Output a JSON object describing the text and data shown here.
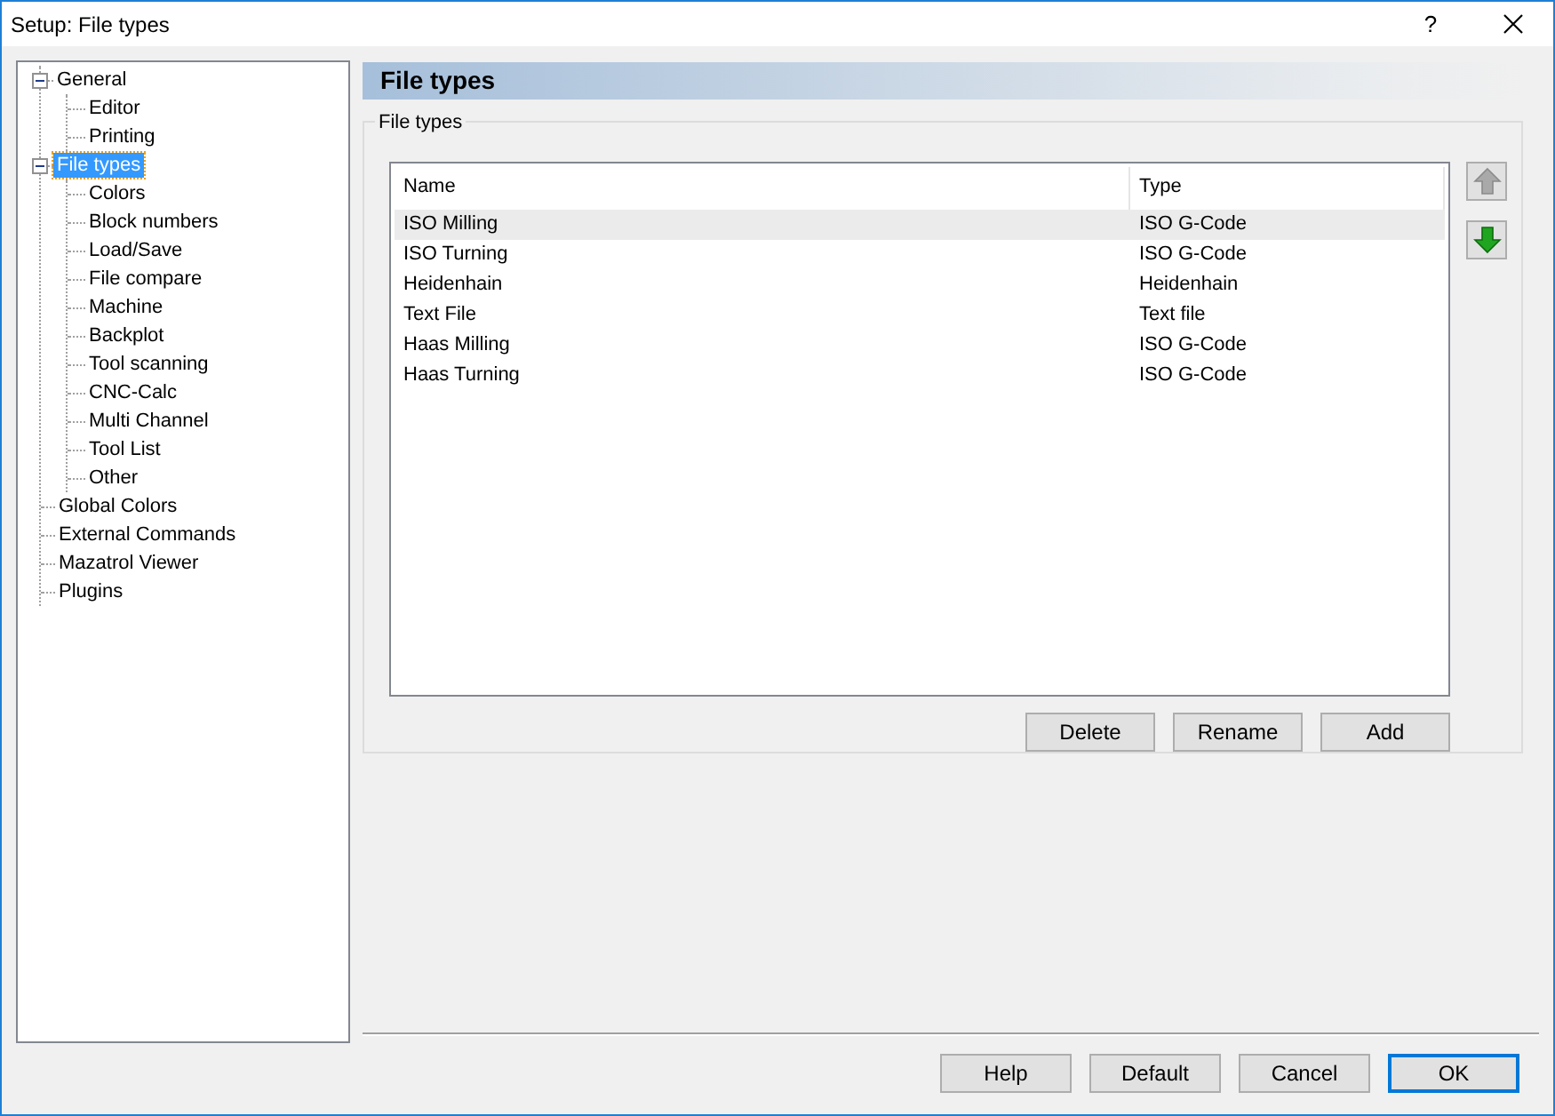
{
  "window": {
    "title": "Setup: File types",
    "help": "?"
  },
  "tree": [
    {
      "label": "General",
      "expanded": true,
      "selected": false,
      "children": [
        {
          "label": "Editor",
          "selected": false
        },
        {
          "label": "Printing",
          "selected": false
        }
      ]
    },
    {
      "label": "File types",
      "expanded": true,
      "selected": true,
      "children": [
        {
          "label": "Colors",
          "selected": false
        },
        {
          "label": "Block numbers",
          "selected": false
        },
        {
          "label": "Load/Save",
          "selected": false
        },
        {
          "label": "File compare",
          "selected": false
        },
        {
          "label": "Machine",
          "selected": false
        },
        {
          "label": "Backplot",
          "selected": false
        },
        {
          "label": "Tool scanning",
          "selected": false
        },
        {
          "label": "CNC-Calc",
          "selected": false
        },
        {
          "label": "Multi Channel",
          "selected": false
        },
        {
          "label": "Tool List",
          "selected": false
        },
        {
          "label": "Other",
          "selected": false
        }
      ]
    },
    {
      "label": "Global Colors",
      "selected": false
    },
    {
      "label": "External Commands",
      "selected": false
    },
    {
      "label": "Mazatrol Viewer",
      "selected": false
    },
    {
      "label": "Plugins",
      "selected": false
    }
  ],
  "page_title": "File types",
  "group_title": "File types",
  "table": {
    "columns": [
      "Name",
      "Type"
    ],
    "rows": [
      {
        "cells": [
          "ISO Milling",
          "ISO G-Code"
        ],
        "selected": true
      },
      {
        "cells": [
          "ISO Turning",
          "ISO G-Code"
        ],
        "selected": false
      },
      {
        "cells": [
          "Heidenhain",
          "Heidenhain"
        ],
        "selected": false
      },
      {
        "cells": [
          "Text File",
          "Text file"
        ],
        "selected": false
      },
      {
        "cells": [
          "Haas Milling",
          "ISO G-Code"
        ],
        "selected": false
      },
      {
        "cells": [
          "Haas Turning",
          "ISO G-Code"
        ],
        "selected": false
      }
    ]
  },
  "move_buttons": [
    {
      "kind": "up",
      "disabled": true
    },
    {
      "kind": "down",
      "disabled": false
    }
  ],
  "list_buttons": [
    "Delete",
    "Rename",
    "Add"
  ],
  "dialog_buttons": [
    {
      "label": "Help",
      "default": false
    },
    {
      "label": "Default",
      "default": false
    },
    {
      "label": "Cancel",
      "default": false
    },
    {
      "label": "OK",
      "default": true
    }
  ]
}
